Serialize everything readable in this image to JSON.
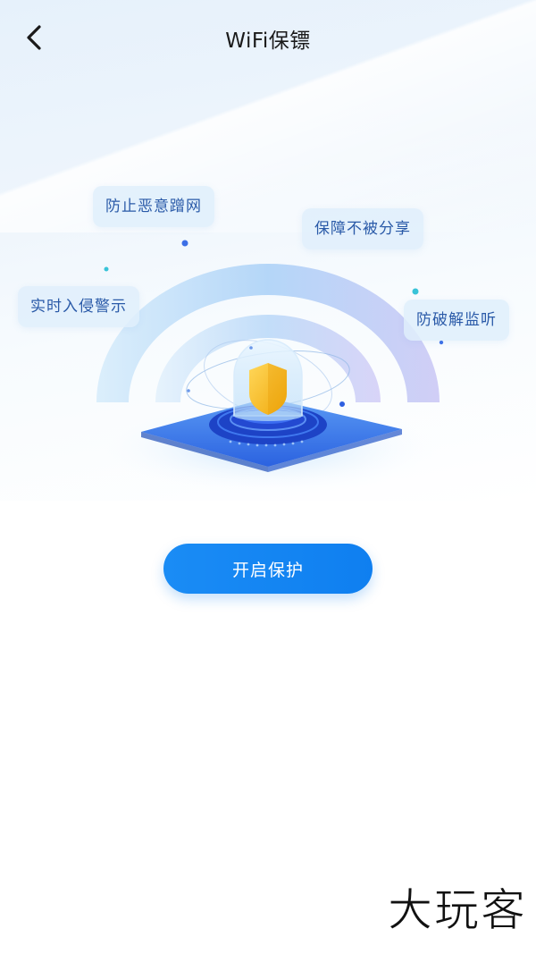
{
  "header": {
    "title": "WiFi保镖",
    "back_icon": "chevron-left-icon"
  },
  "features": [
    {
      "label": "防止恶意蹭网"
    },
    {
      "label": "保障不被分享"
    },
    {
      "label": "实时入侵警示"
    },
    {
      "label": "防破解监听"
    }
  ],
  "illustration": {
    "icon": "shield-icon",
    "colors": {
      "accent": "#1a8cf5",
      "shield": "#f5c21b",
      "platform": "#2f6fe8"
    }
  },
  "action": {
    "label": "开启保护"
  },
  "watermark": {
    "text": "大玩客"
  }
}
